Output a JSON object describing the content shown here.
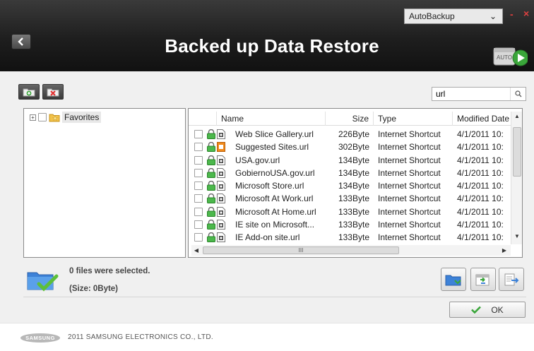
{
  "header": {
    "title": "Backed up Data Restore",
    "mode_selected": "AutoBackup",
    "minimize_label": "-",
    "close_label": "×",
    "autobackup_icon_text": "AUTO"
  },
  "search": {
    "value": "url",
    "placeholder": ""
  },
  "tree": {
    "root_label": "Favorites"
  },
  "columns": {
    "name": "Name",
    "size": "Size",
    "type": "Type",
    "modified": "Modified Date"
  },
  "files": [
    {
      "name": "Web Slice Gallery.url",
      "size": "226Byte",
      "type": "Internet Shortcut",
      "modified": "4/1/2011 10:",
      "icon": "url-file-icon"
    },
    {
      "name": "Suggested Sites.url",
      "size": "302Byte",
      "type": "Internet Shortcut",
      "modified": "4/1/2011 10:",
      "icon": "suggested-sites-icon"
    },
    {
      "name": "USA.gov.url",
      "size": "134Byte",
      "type": "Internet Shortcut",
      "modified": "4/1/2011 10:",
      "icon": "url-file-icon"
    },
    {
      "name": "GobiernoUSA.gov.url",
      "size": "134Byte",
      "type": "Internet Shortcut",
      "modified": "4/1/2011 10:",
      "icon": "url-file-icon"
    },
    {
      "name": "Microsoft Store.url",
      "size": "134Byte",
      "type": "Internet Shortcut",
      "modified": "4/1/2011 10:",
      "icon": "url-file-icon"
    },
    {
      "name": "Microsoft At Work.url",
      "size": "133Byte",
      "type": "Internet Shortcut",
      "modified": "4/1/2011 10:",
      "icon": "url-file-icon"
    },
    {
      "name": "Microsoft At Home.url",
      "size": "133Byte",
      "type": "Internet Shortcut",
      "modified": "4/1/2011 10:",
      "icon": "url-file-icon"
    },
    {
      "name": "IE site on Microsoft...",
      "size": "133Byte",
      "type": "Internet Shortcut",
      "modified": "4/1/2011 10:",
      "icon": "url-file-icon"
    },
    {
      "name": "IE Add-on site.url",
      "size": "133Byte",
      "type": "Internet Shortcut",
      "modified": "4/1/2011 10:",
      "icon": "url-file-icon"
    }
  ],
  "scrollbar": {
    "h_thumb_grip": "III"
  },
  "status": {
    "selected_text": "0 files were selected.",
    "size_text": "(Size: 0Byte)"
  },
  "ok_label": "OK",
  "footer": {
    "logo_text": "SAMSUNG",
    "copyright": "2011 SAMSUNG ELECTRONICS CO., LTD."
  },
  "colors": {
    "header_bg": "#1e1e1e",
    "accent_green": "#3aa63a",
    "close_red": "#e04040"
  }
}
